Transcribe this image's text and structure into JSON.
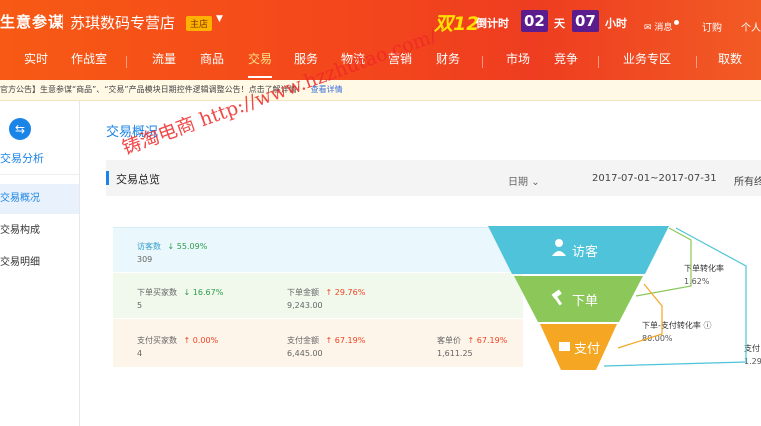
{
  "header": {
    "brand": "生意参谋",
    "store_name": "苏琪数码专营店",
    "store_tag": "主店",
    "promo": "双12",
    "countdown": {
      "label": "倒计时",
      "days": "02",
      "days_unit": "天",
      "hours": "07",
      "hours_unit": "小时"
    },
    "message": "消息",
    "subscribe": "订购",
    "me": "个人"
  },
  "nav": {
    "items": [
      {
        "label": "实时"
      },
      {
        "label": "作战室"
      },
      {
        "label": "流量"
      },
      {
        "label": "商品"
      },
      {
        "label": "交易",
        "active": true
      },
      {
        "label": "服务"
      },
      {
        "label": "物流"
      },
      {
        "label": "营销"
      },
      {
        "label": "财务"
      },
      {
        "label": "市场"
      },
      {
        "label": "竞争"
      },
      {
        "label": "业务专区"
      },
      {
        "label": "取数"
      }
    ]
  },
  "notice": {
    "text": "官方公告】生意参谋“商品”、“交易”产品模块日期控件逻辑调整公告！点击了解详情！",
    "detail_link": "查看详情"
  },
  "sidebar": {
    "title": "交易分析",
    "items": [
      {
        "label": "交易概况",
        "active": true
      },
      {
        "label": "交易构成"
      },
      {
        "label": "交易明细"
      }
    ]
  },
  "main": {
    "page_title": "交易概况",
    "section_title": "交易总览",
    "date_label": "日期",
    "date_range": "2017-07-01~2017-07-31",
    "terminal": "所有终"
  },
  "metrics": {
    "visitors": {
      "label": "访客数",
      "change": "55.09%",
      "direction": "down",
      "value": "309"
    },
    "order_buyers": {
      "label": "下单买家数",
      "change": "16.67%",
      "direction": "down",
      "value": "5"
    },
    "order_amount": {
      "label": "下单金额",
      "change": "29.76%",
      "direction": "up",
      "value": "9,243.00"
    },
    "pay_buyers": {
      "label": "支付买家数",
      "change": "0.00%",
      "direction": "up",
      "value": "4"
    },
    "pay_amount": {
      "label": "支付金额",
      "change": "67.19%",
      "direction": "up",
      "value": "6,445.00"
    },
    "unit_price": {
      "label": "客单价",
      "change": "67.19%",
      "direction": "up",
      "value": "1,611.25"
    }
  },
  "funnel": {
    "visitor": "访客",
    "order": "下单",
    "pay": "支付",
    "order_rate_label": "下单转化率",
    "order_rate": "1.62%",
    "order_pay_rate_label": "下单-支付转化率",
    "order_pay_rate": "80.00%",
    "pay_rate_label": "支付",
    "pay_rate": "1.29",
    "colors": {
      "visitor": "#4fc3d9",
      "order": "#8cc859",
      "pay": "#f5a623"
    }
  },
  "watermark": {
    "text": "铸淘电商 http://www.hzzhutao.com/"
  }
}
